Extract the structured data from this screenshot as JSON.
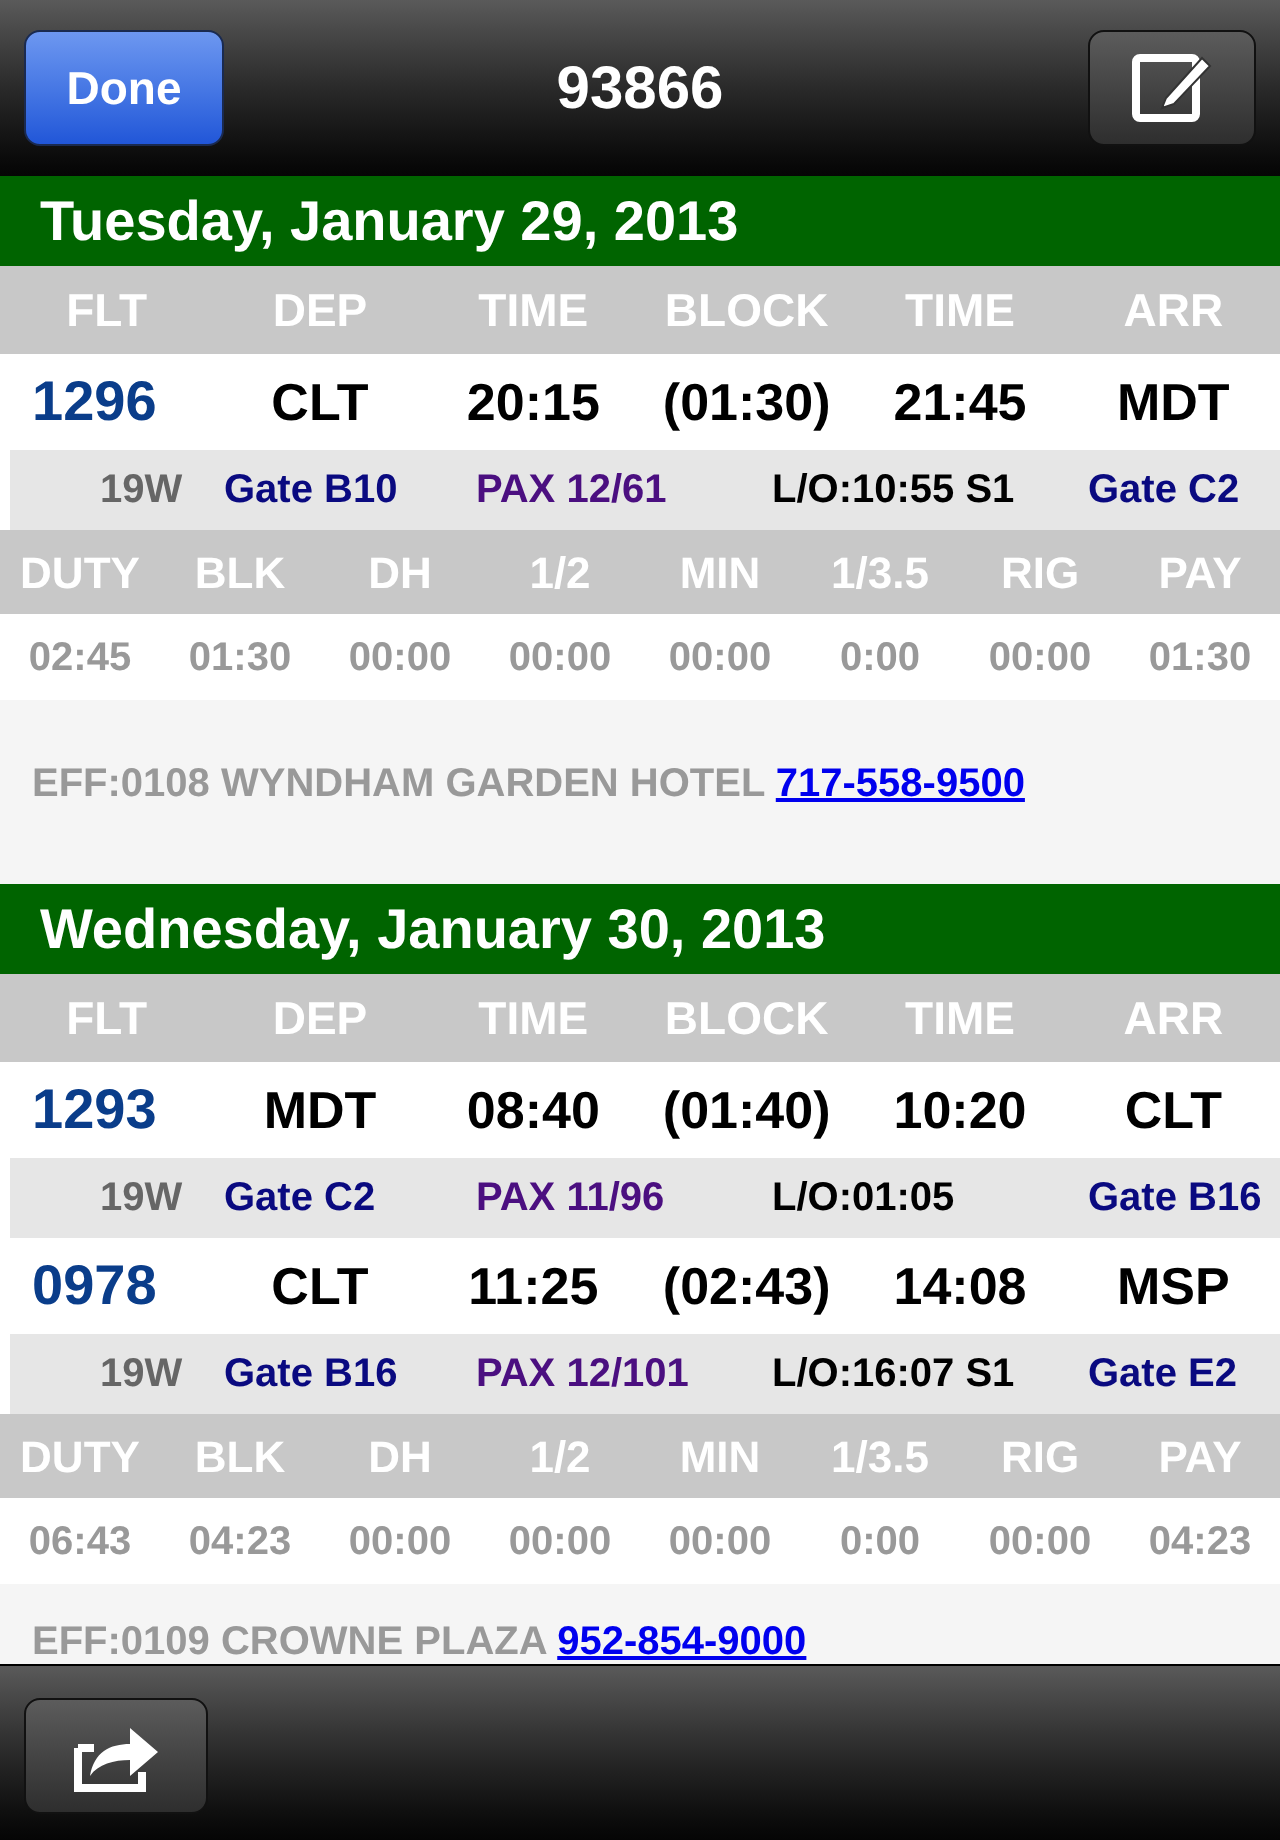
{
  "nav_bar": {
    "done_button": "Done",
    "title": "93866"
  },
  "days": [
    {
      "date": "Tuesday, January 29, 2013",
      "columns": [
        "FLT",
        "DEP",
        "TIME",
        "BLOCK",
        "TIME",
        "ARR"
      ],
      "flights": [
        {
          "flt": "1296",
          "dep": "CLT",
          "dep_time": "20:15",
          "block": "(01:30)",
          "arr_time": "21:45",
          "arr": "MDT",
          "equipment": "19W",
          "dep_gate": "Gate B10",
          "pax": "PAX 12/61",
          "layover": "L/O:10:55 S1",
          "arr_gate": "Gate C2"
        }
      ],
      "pay_columns": [
        "DUTY",
        "BLK",
        "DH",
        "1/2",
        "MIN",
        "1/3.5",
        "RIG",
        "PAY"
      ],
      "pay_values": [
        "02:45",
        "01:30",
        "00:00",
        "00:00",
        "00:00",
        "0:00",
        "00:00",
        "01:30"
      ],
      "hotel": {
        "text": "EFF:0108 WYNDHAM GARDEN HOTEL",
        "phone": "717-558-9500"
      }
    },
    {
      "date": "Wednesday, January 30, 2013",
      "columns": [
        "FLT",
        "DEP",
        "TIME",
        "BLOCK",
        "TIME",
        "ARR"
      ],
      "flights": [
        {
          "flt": "1293",
          "dep": "MDT",
          "dep_time": "08:40",
          "block": "(01:40)",
          "arr_time": "10:20",
          "arr": "CLT",
          "equipment": "19W",
          "dep_gate": "Gate C2",
          "pax": "PAX 11/96",
          "layover": "L/O:01:05",
          "arr_gate": "Gate B16"
        },
        {
          "flt": "0978",
          "dep": "CLT",
          "dep_time": "11:25",
          "block": "(02:43)",
          "arr_time": "14:08",
          "arr": "MSP",
          "equipment": "19W",
          "dep_gate": "Gate B16",
          "pax": "PAX 12/101",
          "layover": "L/O:16:07 S1",
          "arr_gate": "Gate E2"
        }
      ],
      "pay_columns": [
        "DUTY",
        "BLK",
        "DH",
        "1/2",
        "MIN",
        "1/3.5",
        "RIG",
        "PAY"
      ],
      "pay_values": [
        "06:43",
        "04:23",
        "00:00",
        "00:00",
        "00:00",
        "0:00",
        "00:00",
        "04:23"
      ],
      "hotel": {
        "text": "EFF:0109 CROWNE PLAZA",
        "phone": "952-854-9000"
      }
    }
  ]
}
